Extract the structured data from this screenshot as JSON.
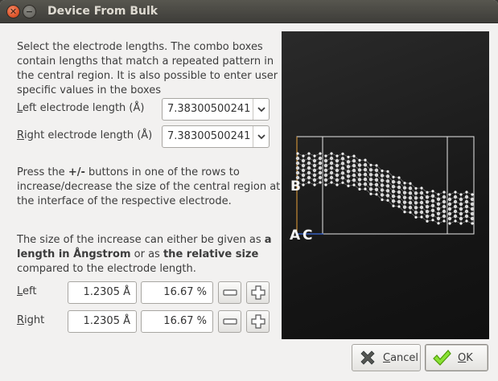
{
  "window": {
    "title": "Device From Bulk"
  },
  "intro": "Select the electrode lengths. The combo boxes contain lengths that match a repeated pattern in the central region. It is also possible to enter user specific values in the boxes",
  "left_electrode": {
    "label_ul": "L",
    "label_rest": "eft electrode length (Å)",
    "value": "7.38300500241"
  },
  "right_electrode": {
    "label_ul": "R",
    "label_rest": "ight electrode length (Å)",
    "value": "7.38300500241"
  },
  "press_text": {
    "pre": "Press the ",
    "bold": "+/-",
    "post": " buttons in one of the rows to increase/decrease the size of the central region at the interface of the respective electrode."
  },
  "size_text": {
    "p1": "The size of the increase can either be given as ",
    "b1": "a length in Ångstrom",
    "p2": " or as ",
    "b2": "the relative size",
    "p3": " compared to the electrode length."
  },
  "rows": [
    {
      "label_ul": "L",
      "label_rest": "eft",
      "length": "1.2305 Å",
      "relative": "16.67 %"
    },
    {
      "label_ul": "R",
      "label_rest": "ight",
      "length": "1.2305 Å",
      "relative": "16.67 %"
    }
  ],
  "preview": {
    "label_b": "B",
    "label_a": "A",
    "label_c": "C"
  },
  "buttons": {
    "cancel_ul": "C",
    "cancel_rest": "ancel",
    "ok_ul": "O",
    "ok_rest": "K"
  },
  "icons": {
    "close": "close-icon",
    "minimize": "minimize-icon",
    "dropdown": "chevron-down-icon",
    "minus": "minus-icon",
    "plus": "plus-icon",
    "cancel": "cancel-x-icon",
    "ok": "checkmark-icon"
  },
  "colors": {
    "titlebar": "#3e3d39",
    "close_button": "#e0562c",
    "preview_bg": "#1a1a1a",
    "ok_check": "#4e9a06",
    "cancel_x": "#555753"
  }
}
